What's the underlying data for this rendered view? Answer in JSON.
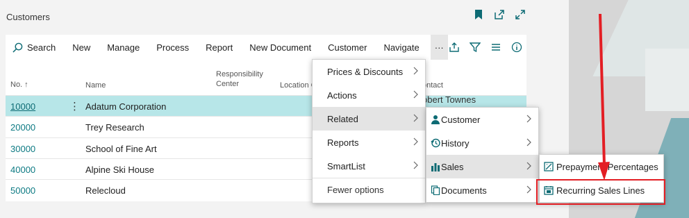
{
  "window": {
    "title": "Customers"
  },
  "actionbar": {
    "search_label": "Search",
    "items": [
      "New",
      "Manage",
      "Process",
      "Report",
      "New Document",
      "Customer",
      "Navigate"
    ],
    "more_label": "···"
  },
  "list": {
    "headers": {
      "no": "No. ↑",
      "name": "Name",
      "responsibility_center": "Responsibility Center",
      "location": "Location C",
      "contact": "ontact"
    },
    "rows": [
      {
        "no": "10000",
        "name": "Adatum Corporation",
        "contact": "obert Townes"
      },
      {
        "no": "20000",
        "name": "Trey Research"
      },
      {
        "no": "30000",
        "name": "School of Fine Art"
      },
      {
        "no": "40000",
        "name": "Alpine Ski House"
      },
      {
        "no": "50000",
        "name": "Relecloud"
      }
    ],
    "row_menu": "⋮"
  },
  "menu_more": {
    "items": [
      "Prices & Discounts",
      "Actions",
      "Related",
      "Reports",
      "SmartList"
    ],
    "fewer": "Fewer options"
  },
  "menu_related": {
    "items": [
      "Customer",
      "History",
      "Sales",
      "Documents"
    ]
  },
  "menu_sales": {
    "items": [
      "Prepayment Percentages",
      "Recurring Sales Lines"
    ]
  },
  "colors": {
    "accent": "#0d7a83",
    "selected_row": "#b7e6e8",
    "highlight": "#e31e24"
  }
}
